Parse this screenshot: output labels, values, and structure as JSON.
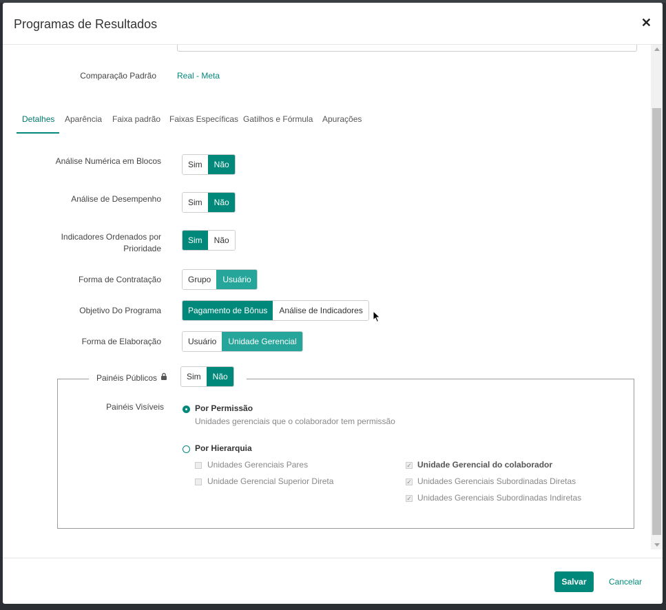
{
  "modal": {
    "title": "Programas de Resultados"
  },
  "comparacao": {
    "label": "Comparação Padrão",
    "value": "Real - Meta"
  },
  "tabs": [
    "Detalhes",
    "Aparência",
    "Faixa padrão",
    "Faixas Específicas",
    "Gatilhos e Fórmula",
    "Apurações"
  ],
  "fields": {
    "analise_numerica": {
      "label": "Análise Numérica em Blocos",
      "options": [
        "Sim",
        "Não"
      ],
      "selected": "Não"
    },
    "analise_desempenho": {
      "label": "Análise de Desempenho",
      "options": [
        "Sim",
        "Não"
      ],
      "selected": "Não"
    },
    "indicadores_ordenados": {
      "label_line1": "Indicadores Ordenados por",
      "label_line2": "Prioridade",
      "options": [
        "Sim",
        "Não"
      ],
      "selected": "Sim"
    },
    "forma_contratacao": {
      "label": "Forma de Contratação",
      "options": [
        "Grupo",
        "Usuário"
      ],
      "selected": "Usuário"
    },
    "objetivo_programa": {
      "label": "Objetivo Do Programa",
      "options": [
        "Pagamento de Bônus",
        "Análise de Indicadores"
      ],
      "selected": "Pagamento de Bônus"
    },
    "forma_elaboracao": {
      "label": "Forma de Elaboração",
      "options": [
        "Usuário",
        "Unidade Gerencial"
      ],
      "selected": "Unidade Gerencial"
    }
  },
  "paineis_publicos": {
    "label": "Painéis Públicos",
    "options": [
      "Sim",
      "Não"
    ],
    "selected": "Não",
    "visiveis_label": "Painéis Visíveis",
    "por_permissao": {
      "label": "Por Permissão",
      "hint": "Unidades gerenciais que o colaborador tem permissão",
      "selected": true
    },
    "por_hierarquia": {
      "label": "Por Hierarquia",
      "selected": false,
      "left_options": [
        "Unidades Gerenciais Pares",
        "Unidade Gerencial Superior Direta"
      ],
      "right_options": [
        "Unidade Gerencial do colaborador",
        "Unidades Gerenciais Subordinadas Diretas",
        "Unidades Gerenciais Subordinadas Indiretas"
      ]
    }
  },
  "footer": {
    "save": "Salvar",
    "cancel": "Cancelar"
  },
  "colors": {
    "accent": "#00897b",
    "accent_light": "#26a69a"
  }
}
